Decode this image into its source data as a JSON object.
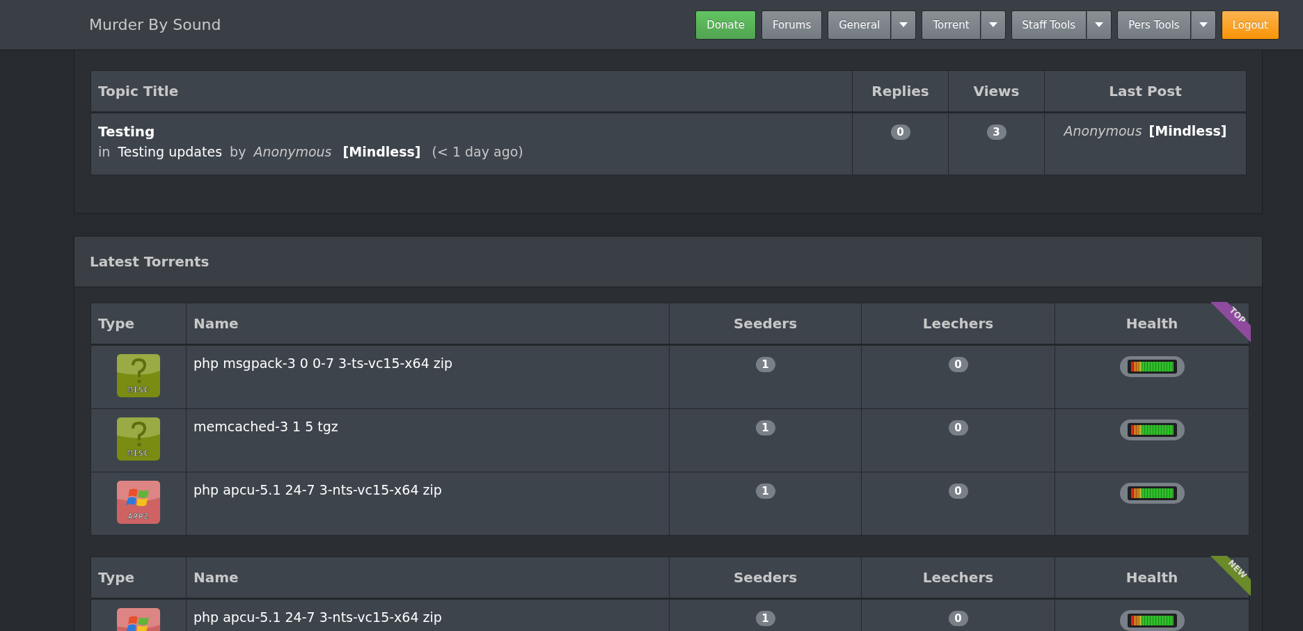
{
  "header": {
    "brand": "Murder By Sound",
    "buttons": [
      {
        "label": "Donate",
        "kind": "success",
        "dropdown": false
      },
      {
        "label": "Forums",
        "kind": "default",
        "dropdown": false
      },
      {
        "label": "General",
        "kind": "default",
        "dropdown": true
      },
      {
        "label": "Torrent",
        "kind": "default",
        "dropdown": true
      },
      {
        "label": "Staff Tools",
        "kind": "default",
        "dropdown": true
      },
      {
        "label": "Pers Tools",
        "kind": "default",
        "dropdown": true
      },
      {
        "label": "Logout",
        "kind": "warning",
        "dropdown": false
      }
    ]
  },
  "topics": {
    "columns": [
      "Topic Title",
      "Replies",
      "Views",
      "Last Post"
    ],
    "rows": [
      {
        "title": "Testing",
        "prefix": "in",
        "forum": "Testing updates",
        "by": "by",
        "author": "Anonymous",
        "author_class": "[Mindless]",
        "time": "(< 1 day ago)",
        "replies": "0",
        "views": "3",
        "last_post_author": "Anonymous",
        "last_post_class": "[Mindless]"
      }
    ]
  },
  "latest_torrents": {
    "title": "Latest Torrents",
    "tables": [
      {
        "ribbon": {
          "label": "TOP",
          "color": "#8e4b9e"
        },
        "columns": [
          "Type",
          "Name",
          "Seeders",
          "Leechers",
          "Health"
        ],
        "rows": [
          {
            "kind": "misc",
            "type_label": "MISC",
            "name": "php msgpack-3 0 0-7 3-ts-vc15-x64 zip",
            "seeders": "1",
            "leechers": "0",
            "level": 1
          },
          {
            "kind": "misc",
            "type_label": "MISC",
            "name": "memcached-3 1 5 tgz",
            "seeders": "1",
            "leechers": "0",
            "level": 1
          },
          {
            "kind": "appz",
            "type_label": "APPZ",
            "name": "php apcu-5.1 24-7 3-nts-vc15-x64 zip",
            "seeders": "1",
            "leechers": "0",
            "level": 1
          }
        ]
      },
      {
        "ribbon": {
          "label": "NEW",
          "color": "#6b8a2a"
        },
        "columns": [
          "Type",
          "Name",
          "Seeders",
          "Leechers",
          "Health"
        ],
        "rows": [
          {
            "kind": "appz",
            "name": "php apcu-5.1 24-7 3-nts-vc15-x64 zip",
            "seeders": "1",
            "leechers": "0",
            "level": 1
          }
        ]
      }
    ]
  }
}
